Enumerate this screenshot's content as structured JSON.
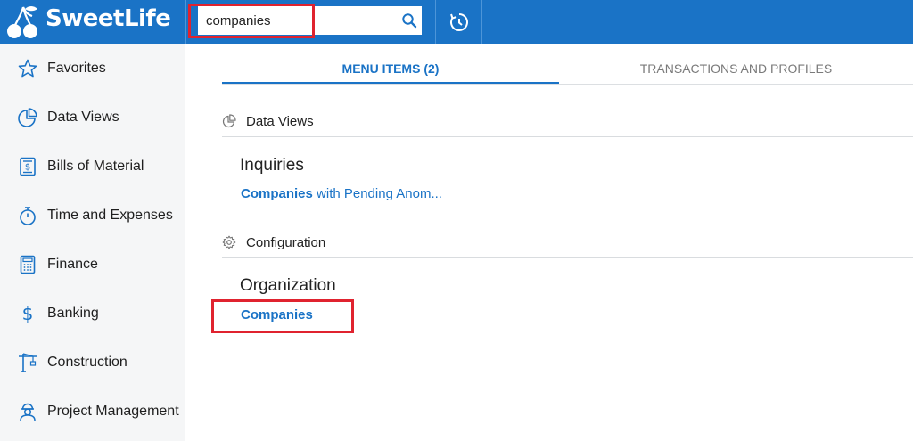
{
  "brand": {
    "name": "SweetLife"
  },
  "search": {
    "value": "companies",
    "placeholder": ""
  },
  "sidebar": {
    "items": [
      {
        "label": "Favorites",
        "icon": "star-icon"
      },
      {
        "label": "Data Views",
        "icon": "pie-chart-icon"
      },
      {
        "label": "Bills of Material",
        "icon": "invoice-icon"
      },
      {
        "label": "Time and Expenses",
        "icon": "stopwatch-icon"
      },
      {
        "label": "Finance",
        "icon": "calculator-icon"
      },
      {
        "label": "Banking",
        "icon": "dollar-icon"
      },
      {
        "label": "Construction",
        "icon": "crane-icon"
      },
      {
        "label": "Project Management",
        "icon": "worker-icon"
      }
    ]
  },
  "tabs": [
    {
      "label": "MENU ITEMS  (2)",
      "active": true
    },
    {
      "label": "TRANSACTIONS AND PROFILES",
      "active": false
    }
  ],
  "sections": [
    {
      "label": "Data Views",
      "icon": "pie-chart-icon",
      "group": "Inquiries",
      "result": {
        "match": "Companies",
        "rest": " with Pending Anom..."
      }
    },
    {
      "label": "Configuration",
      "icon": "gear-icon",
      "group": "Organization",
      "result": {
        "match": "Companies",
        "rest": ""
      }
    }
  ],
  "colors": {
    "brand": "#1a73c6",
    "highlight": "#e0232f"
  }
}
